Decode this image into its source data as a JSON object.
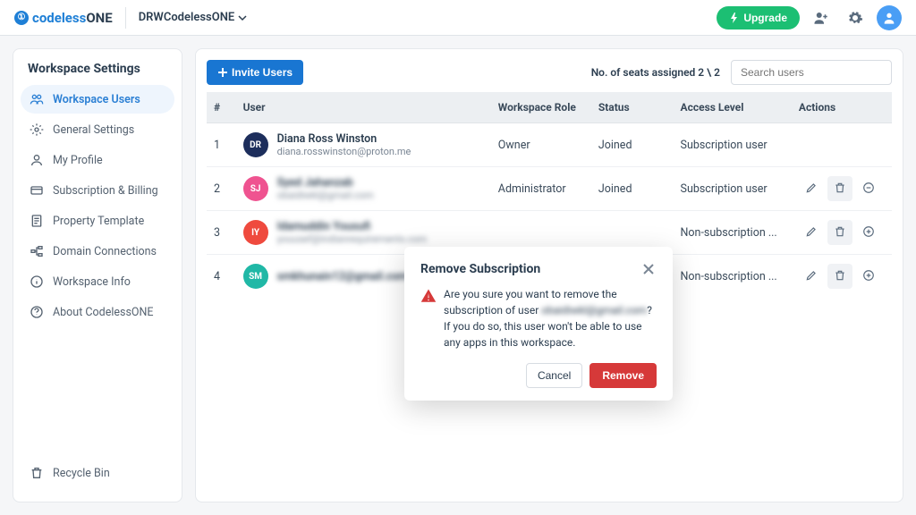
{
  "topbar": {
    "brand_prefix": "codeless",
    "brand_suffix": "ONE",
    "workspace_name": "DRWCodelessONE",
    "upgrade_label": "Upgrade"
  },
  "sidebar": {
    "title": "Workspace Settings",
    "items": [
      {
        "label": "Workspace Users",
        "icon": "users-icon",
        "active": true
      },
      {
        "label": "General Settings",
        "icon": "gear-icon",
        "active": false
      },
      {
        "label": "My Profile",
        "icon": "person-icon",
        "active": false
      },
      {
        "label": "Subscription & Billing",
        "icon": "card-icon",
        "active": false
      },
      {
        "label": "Property Template",
        "icon": "template-icon",
        "active": false
      },
      {
        "label": "Domain Connections",
        "icon": "domain-icon",
        "active": false
      },
      {
        "label": "Workspace Info",
        "icon": "info-icon",
        "active": false
      },
      {
        "label": "About CodelessONE",
        "icon": "about-icon",
        "active": false
      }
    ],
    "footer_item": {
      "label": "Recycle Bin",
      "icon": "trash-icon"
    }
  },
  "main": {
    "invite_label": "Invite Users",
    "seats_text": "No. of seats assigned 2 \\ 2",
    "search_placeholder": "Search users",
    "columns": {
      "num": "#",
      "user": "User",
      "role": "Workspace Role",
      "status": "Status",
      "access": "Access Level",
      "actions": "Actions"
    },
    "rows": [
      {
        "n": "1",
        "initials": "DR",
        "avatar_color": "#1d2e5c",
        "name": "Diana Ross Winston",
        "email": "diana.rosswinston@proton.me",
        "role": "Owner",
        "status": "Joined",
        "access": "Subscription user",
        "blurred": false,
        "show_actions": false
      },
      {
        "n": "2",
        "initials": "SJ",
        "avatar_color": "#ef5390",
        "name": "Syed Jahanzab",
        "email": "obaidiwkl@gmail.com",
        "role": "Administrator",
        "status": "Joined",
        "access": "Subscription user",
        "blurred": true,
        "show_actions": true,
        "third_action": "minus"
      },
      {
        "n": "3",
        "initials": "IY",
        "avatar_color": "#ef4a3e",
        "name": "Idamuddin Yousufi",
        "email": "youusef@indianrequirements.com",
        "role": "",
        "status": "",
        "access": "Non-subscription ...",
        "blurred": true,
        "show_actions": true,
        "third_action": "plus"
      },
      {
        "n": "4",
        "initials": "SM",
        "avatar_color": "#20b8a6",
        "name": "smkhunain12@gmail.com",
        "email": "",
        "role": "",
        "status": "",
        "access": "Non-subscription ...",
        "blurred": true,
        "show_actions": true,
        "third_action": "plus"
      }
    ]
  },
  "dialog": {
    "title": "Remove Subscription",
    "body_prefix": "Are you sure you want to remove the subscription of user ",
    "body_user": "obaidiwkl@gmail.com",
    "body_suffix": "? If you do so, this user won't be able to use any apps in this workspace.",
    "cancel_label": "Cancel",
    "remove_label": "Remove"
  }
}
